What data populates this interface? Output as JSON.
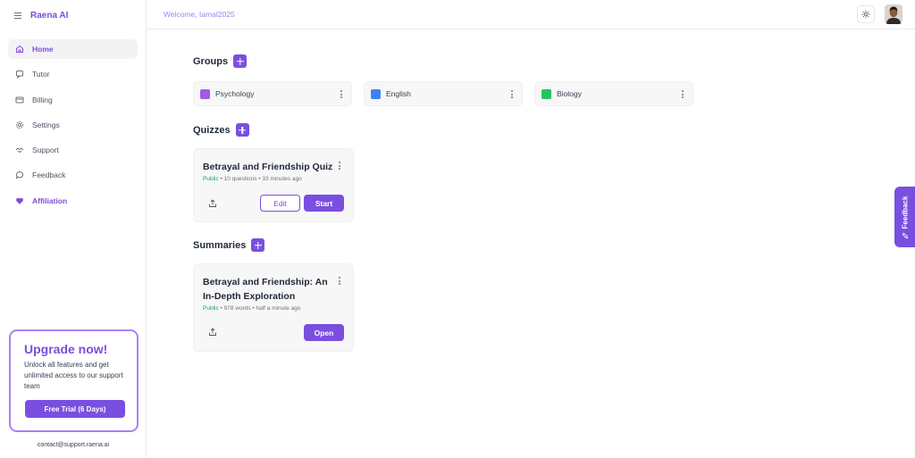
{
  "app": {
    "title": "Raena AI"
  },
  "sidebar": {
    "items": [
      {
        "label": "Home",
        "icon": "home-icon",
        "active": true
      },
      {
        "label": "Tutor",
        "icon": "chat-icon"
      },
      {
        "label": "Billing",
        "icon": "credit-card-icon"
      },
      {
        "label": "Settings",
        "icon": "gear-icon"
      },
      {
        "label": "Support",
        "icon": "handshake-icon"
      },
      {
        "label": "Feedback",
        "icon": "message-icon"
      },
      {
        "label": "Affiliation",
        "icon": "heart-icon"
      }
    ],
    "upgrade": {
      "title": "Upgrade now!",
      "text": "Unlock all features and get unlimited access to our support team",
      "button": "Free Trial (6 Days)"
    },
    "contact": "contact@support.raena.ai"
  },
  "header": {
    "welcome": "Welcome, tamal2025"
  },
  "groups": {
    "title": "Groups",
    "items": [
      {
        "name": "Psychology",
        "color": "#a259e6"
      },
      {
        "name": "English",
        "color": "#3b82f6"
      },
      {
        "name": "Biology",
        "color": "#22c55e"
      }
    ]
  },
  "quizzes": {
    "title": "Quizzes",
    "items": [
      {
        "title": "Betrayal and Friendship Quiz",
        "visibility": "Public",
        "detail": " • 10 questions • 33 minutes ago",
        "edit": "Edit",
        "start": "Start"
      }
    ]
  },
  "summaries": {
    "title": "Summaries",
    "items": [
      {
        "title": "Betrayal and Friendship: An In-Depth Exploration",
        "visibility": "Public",
        "detail": " • 978 words • half a minute ago",
        "open": "Open"
      }
    ]
  },
  "feedback_tab": {
    "label": "Feedback"
  },
  "colors": {
    "accent": "#7a4fe0",
    "public": "#22a06b"
  }
}
